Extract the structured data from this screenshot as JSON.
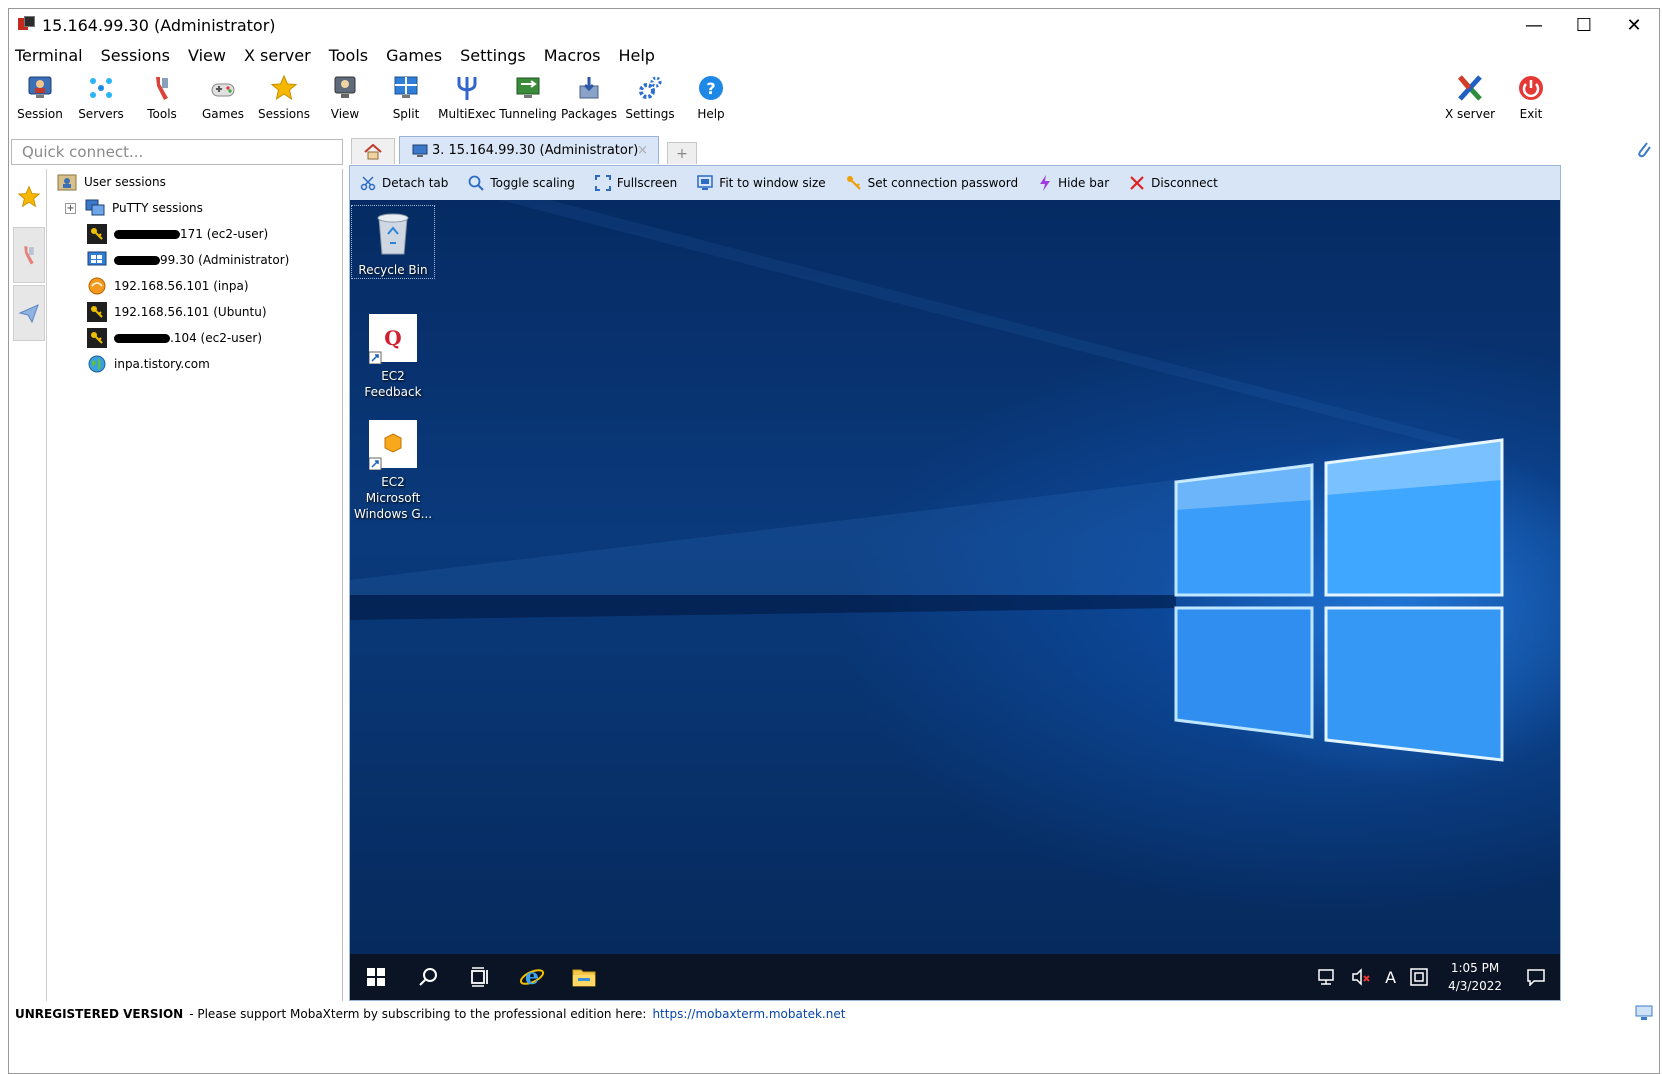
{
  "window": {
    "title": "15.164.99.30 (Administrator)",
    "controls": [
      "—",
      "☐",
      "✕"
    ]
  },
  "menu": [
    "Terminal",
    "Sessions",
    "View",
    "X server",
    "Tools",
    "Games",
    "Settings",
    "Macros",
    "Help"
  ],
  "toolbar": {
    "session": "Session",
    "servers": "Servers",
    "tools": "Tools",
    "games": "Games",
    "sessions": "Sessions",
    "view": "View",
    "split": "Split",
    "multiexec": "MultiExec",
    "tunneling": "Tunneling",
    "packages": "Packages",
    "settings": "Settings",
    "help": "Help",
    "xserver": "X server",
    "exit": "Exit"
  },
  "quick_connect": {
    "placeholder": "Quick connect..."
  },
  "tabs": {
    "active": "3. 15.164.99.30 (Administrator)",
    "close": "×",
    "add": "+"
  },
  "sessions_tree": {
    "root": "User sessions",
    "putty": "PuTTY sessions",
    "expander": "+",
    "items": [
      {
        "suffix": "171 (ec2-user)"
      },
      {
        "suffix": "99.30 (Administrator)"
      },
      {
        "label": "192.168.56.101 (inpa)"
      },
      {
        "label": "192.168.56.101 (Ubuntu)"
      },
      {
        "suffix": ".104 (ec2-user)"
      },
      {
        "label": "inpa.tistory.com"
      }
    ]
  },
  "rdp_bar": {
    "detach": "Detach tab",
    "toggle_scaling": "Toggle scaling",
    "fullscreen": "Fullscreen",
    "fit": "Fit to window size",
    "set_password": "Set connection password",
    "hide_bar": "Hide bar",
    "disconnect": "Disconnect"
  },
  "desktop": {
    "icons": [
      {
        "line1": "Recycle Bin"
      },
      {
        "line1": "EC2 Feedback"
      },
      {
        "line1": "EC2 Microsoft",
        "line2": "Windows G..."
      }
    ],
    "taskbar": {
      "ime": "A",
      "time": "1:05 PM",
      "date": "4/3/2022"
    }
  },
  "status_bar": {
    "unregistered": "UNREGISTERED VERSION",
    "message": " -  Please support MobaXterm by subscribing to the professional edition here:",
    "link": "https://mobaxterm.mobatek.net"
  }
}
